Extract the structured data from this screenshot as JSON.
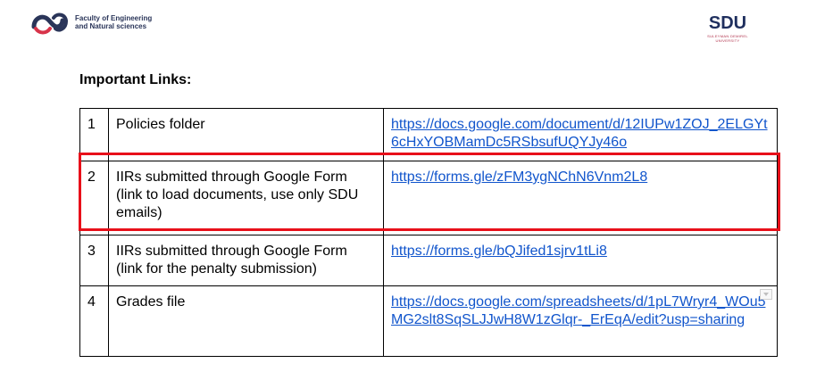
{
  "header": {
    "faculty_line1": "Faculty of Engineering",
    "faculty_line2": "and Natural sciences",
    "university_mark": "SDU",
    "university_name_line1": "SULEYMAN DEMIREL",
    "university_name_line2": "UNIVERSITY",
    "faculty_icon": "faculty-logo-icon",
    "university_icon": "sdu-logo-icon"
  },
  "heading": "Important Links:",
  "table": {
    "rows": [
      {
        "num": "1",
        "description": "Policies folder",
        "link": "https://docs.google.com/document/d/12IUPw1ZOJ_2ELGYt6cHxYOBMamDc5RSbsufUQYJy46o"
      },
      {
        "num": "2",
        "description": "IIRs submitted through Google Form (link to load documents, use only SDU emails)",
        "link": "https://forms.gle/zFM3ygNChN6Vnm2L8"
      },
      {
        "num": "3",
        "description": "IIRs submitted through Google Form (link for the penalty submission)",
        "link": "https://forms.gle/bQJifed1sjrv1tLi8"
      },
      {
        "num": "4",
        "description": "Grades file",
        "link": "https://docs.google.com/spreadsheets/d/1pL7Wryr4_WOu5MG2slt8SqSLJJwH8W1zGlqr-_ErEqA/edit?usp=sharing"
      }
    ]
  },
  "colors": {
    "link": "#1155cc",
    "highlight": "#e8101a",
    "faculty_blue": "#2a3559",
    "faculty_red": "#d8344a",
    "sdu_navy": "#1f2f5e",
    "sdu_red": "#b0304a"
  }
}
